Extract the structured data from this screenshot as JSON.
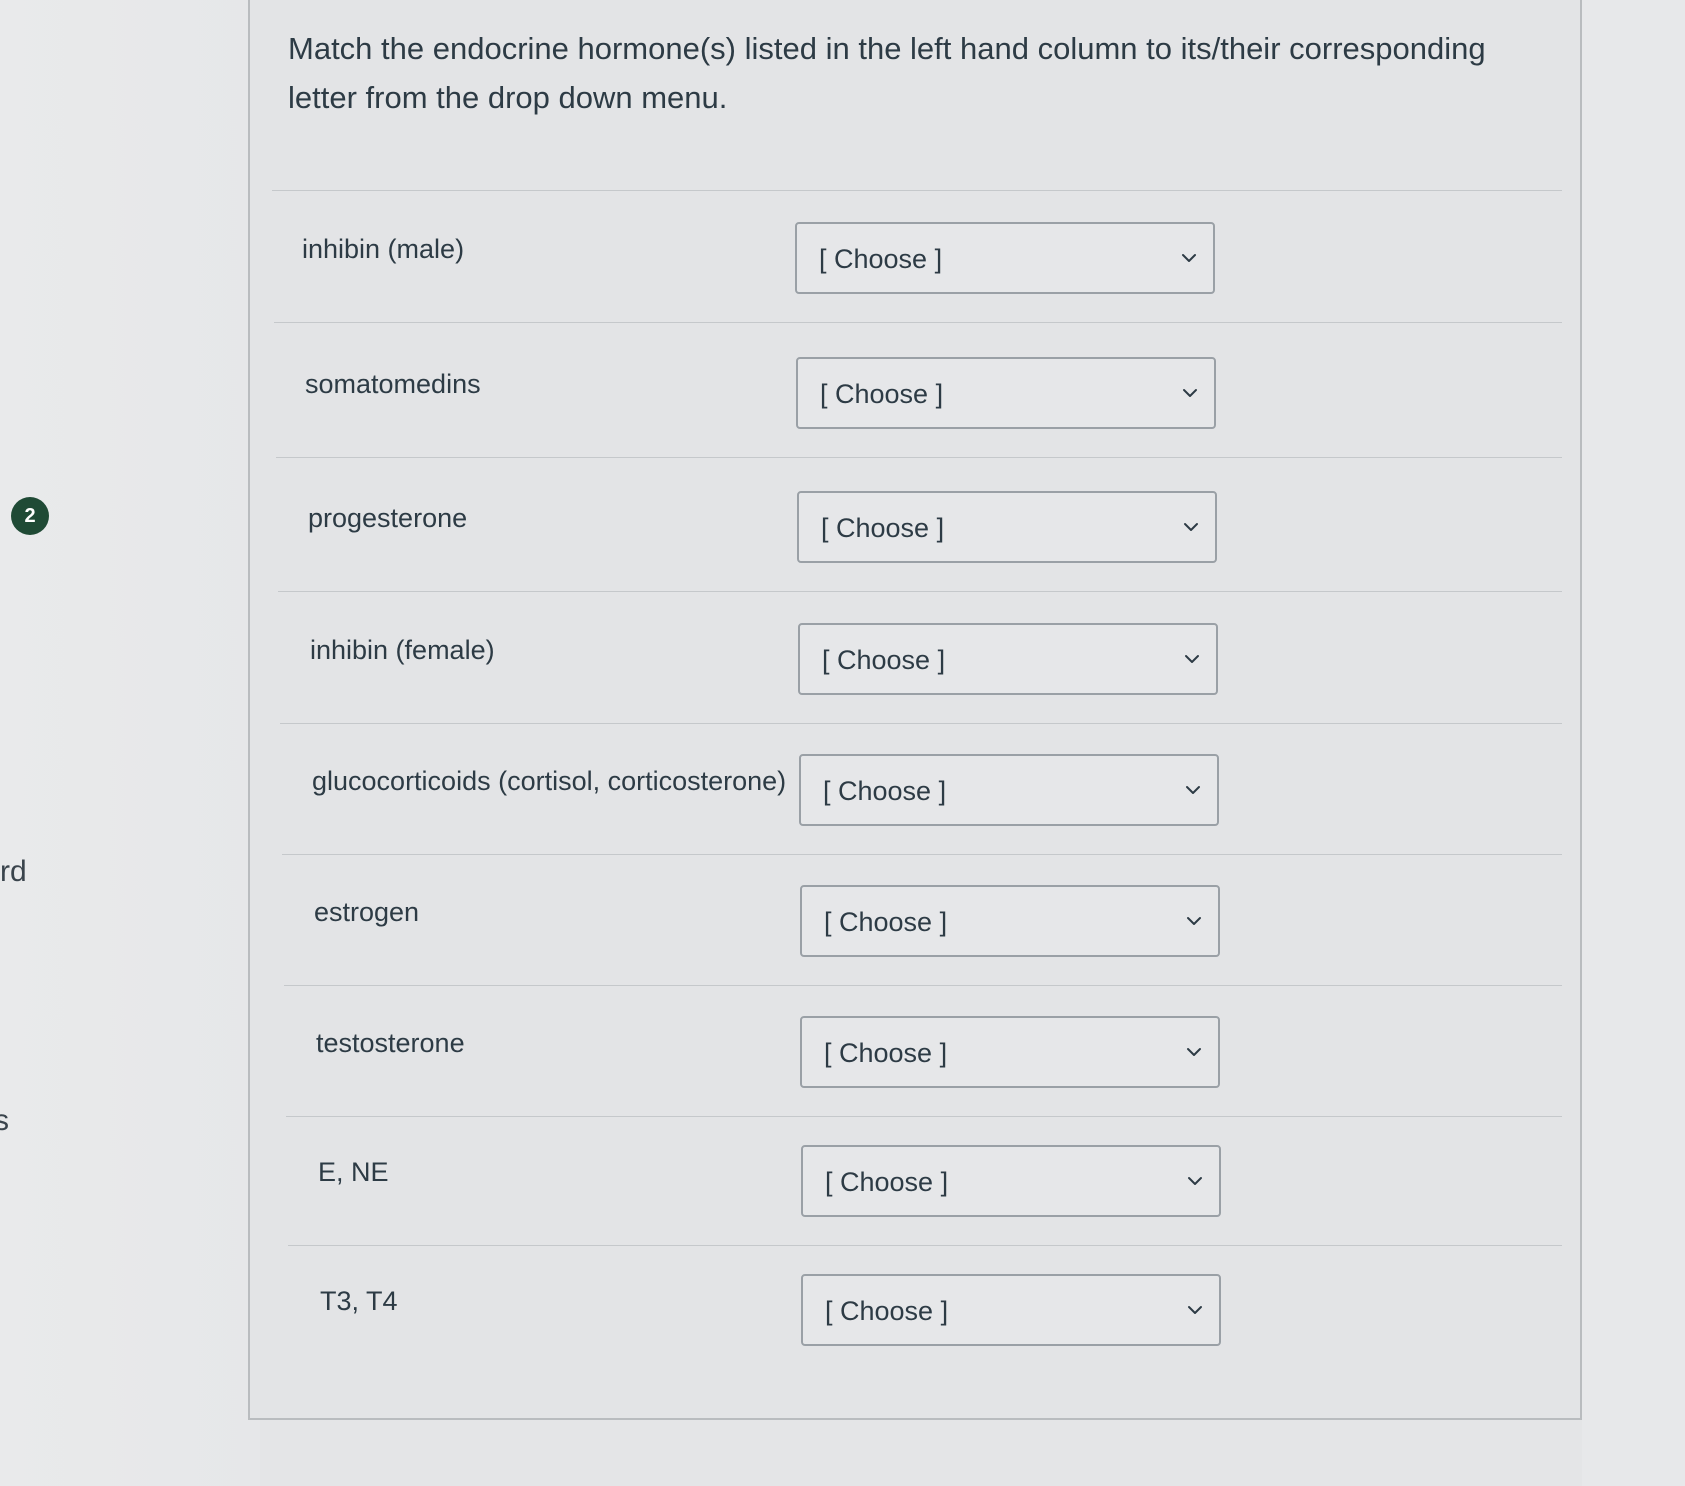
{
  "question": {
    "number": "2",
    "prompt": "Match the endocrine hormone(s) listed in the left hand column to its/their corresponding letter from the drop down menu."
  },
  "gutter": {
    "fragment_1": "rd",
    "fragment_2": "s"
  },
  "items": [
    {
      "label": "inhibin (male)",
      "selected": "[ Choose ]"
    },
    {
      "label": "somatomedins",
      "selected": "[ Choose ]"
    },
    {
      "label": "progesterone",
      "selected": "[ Choose ]"
    },
    {
      "label": "inhibin (female)",
      "selected": "[ Choose ]"
    },
    {
      "label": "glucocorticoids (cortisol, corticosterone)",
      "selected": "[ Choose ]"
    },
    {
      "label": "estrogen",
      "selected": "[ Choose ]"
    },
    {
      "label": "testosterone",
      "selected": "[ Choose ]"
    },
    {
      "label": "E, NE",
      "selected": "[ Choose ]"
    },
    {
      "label": "T3, T4",
      "selected": "[ Choose ]"
    }
  ],
  "icons": {
    "dropdown": "chevron-down-icon"
  },
  "colors": {
    "badge": "#1f4a35",
    "text": "#2d3b45",
    "border": "#9aa0a6"
  }
}
